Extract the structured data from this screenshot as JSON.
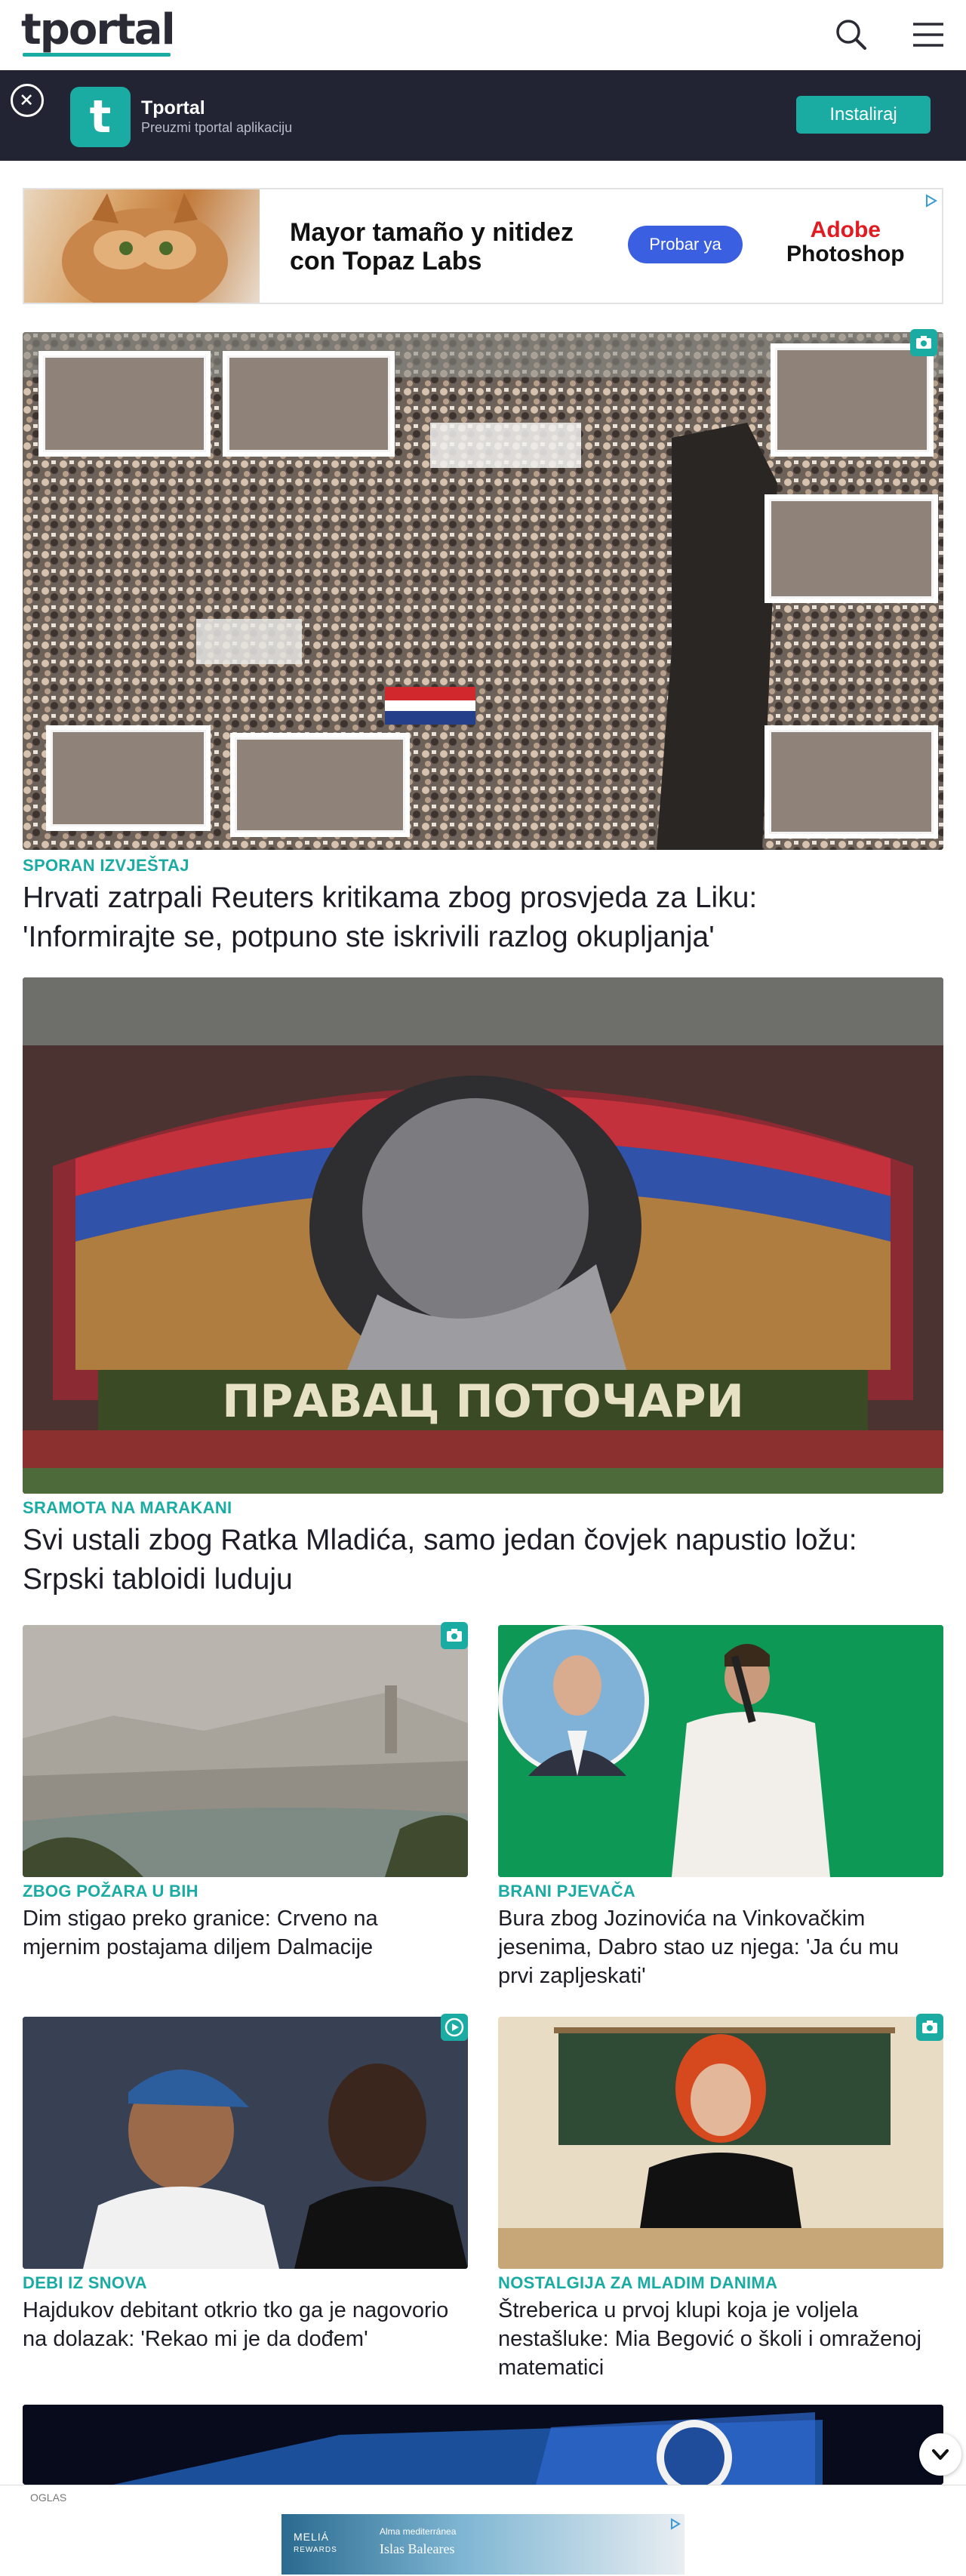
{
  "header": {
    "logo": "tportal",
    "search_icon": "search-icon",
    "menu_icon": "hamburger-menu-icon"
  },
  "app_banner": {
    "close_icon": "close-icon",
    "app_icon_letter": "t",
    "app_name": "Tportal",
    "app_subtitle": "Preuzmi tportal aplikaciju",
    "install_label": "Instaliraj"
  },
  "top_ad": {
    "headline": "Mayor tamaño y nitidez con Topaz Labs",
    "cta": "Probar ya",
    "brand_line1": "Adobe",
    "brand_line2": "Photoshop"
  },
  "articles": [
    {
      "kicker": "SPORAN IZVJEŠTAJ",
      "title": "Hrvati zatrpali Reuters kritikama zbog prosvjeda za Liku: 'Informirajte se, potpuno ste iskrivili razlog okupljanja'",
      "badge": "camera-icon"
    },
    {
      "kicker": "SRAMOTA NA MARAKANI",
      "title": "Svi ustali zbog Ratka Mladića, samo jedan čovjek napustio ložu: Srpski tabloidi luduju",
      "banner_text": "ПРАВАЦ ПОТОЧАРИ"
    },
    {
      "kicker": "ZBOG POŽARA U BIH",
      "title": "Dim stigao preko granice: Crveno na mjernim postajama diljem Dalmacije",
      "badge": "camera-icon"
    },
    {
      "kicker": "BRANI PJEVAČA",
      "title": "Bura zbog Jozinovića na Vinkovačkim jesenima, Dabro stao uz njega: 'Ja ću mu prvi zapljeskati'"
    },
    {
      "kicker": "DEBI IZ SNOVA",
      "title": "Hajdukov debitant otkrio tko ga je nagovorio na dolazak: 'Rekao mi je da dođem'",
      "badge": "play-icon"
    },
    {
      "kicker": "NOSTALGIJA ZA MLADIM DANIMA",
      "title": "Štreberica u prvoj klupi koja je voljela nestašluke: Mia Begović o školi i omraženoj matematici",
      "badge": "camera-icon"
    }
  ],
  "bottom_ad": {
    "label": "OGLAS",
    "brand": "MELIÁ",
    "brand_sub": "REWARDS",
    "tag": "Alma mediterránea",
    "place": "Islas Baleares"
  },
  "scroll_button_icon": "chevron-down-icon",
  "colors": {
    "accent": "#1aaba2",
    "app_banner_bg": "#222433",
    "text": "#1d1d27"
  }
}
